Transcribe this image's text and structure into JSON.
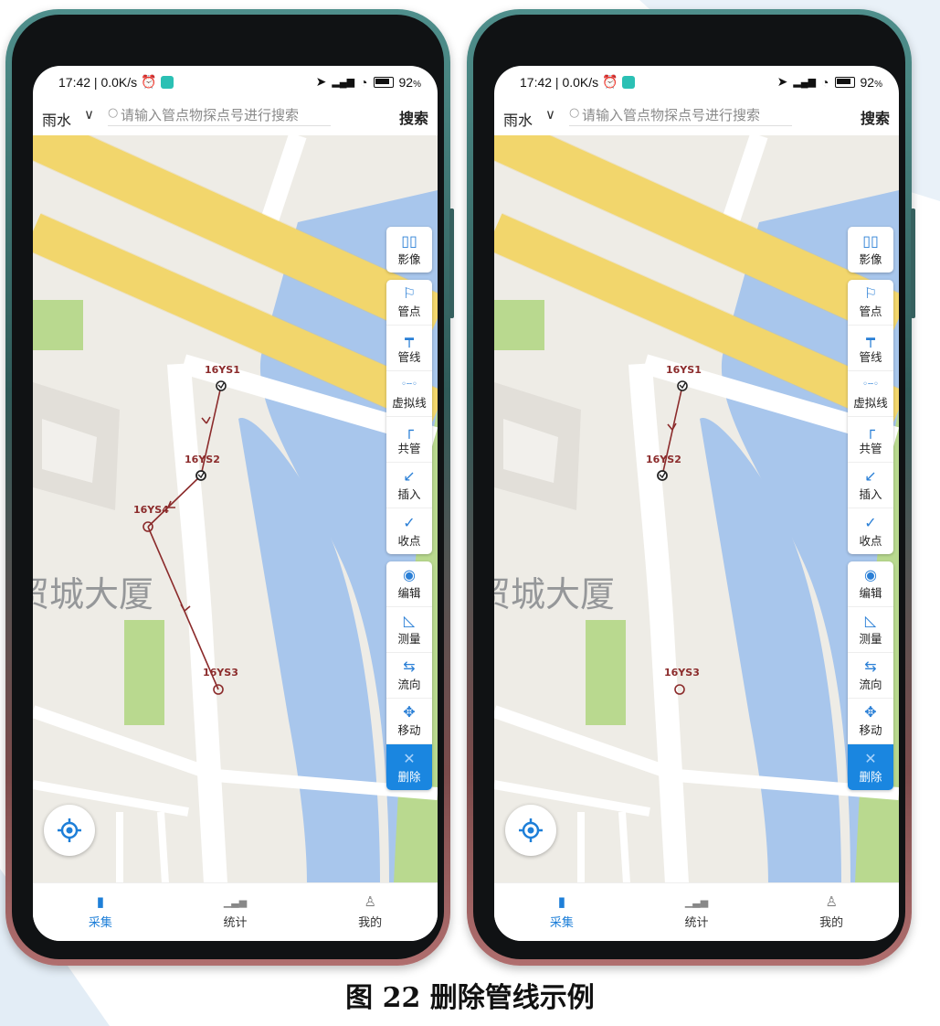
{
  "caption": "图 22 删除管线示例",
  "phones": [
    {
      "status": {
        "time": "17:42 | 0.0K/s",
        "battery": "92"
      },
      "search": {
        "category": "雨水",
        "placeholder": "请输入管点物探点号进行搜索",
        "button": "搜索"
      },
      "map_label": "贸城大厦",
      "points": [
        "16YS1",
        "16YS2",
        "16YS4",
        "16YS3"
      ],
      "toolbar": {
        "group1": [
          {
            "label": "影像",
            "icon": "map-icon"
          }
        ],
        "group2": [
          {
            "label": "管点",
            "icon": "flag-icon"
          },
          {
            "label": "管线",
            "icon": "pipe-line-icon"
          },
          {
            "label": "虚拟线",
            "icon": "dotted-line-icon"
          },
          {
            "label": "共管",
            "icon": "shared-pipe-icon"
          },
          {
            "label": "插入",
            "icon": "insert-icon"
          },
          {
            "label": "收点",
            "icon": "check-circle-icon"
          }
        ],
        "group3": [
          {
            "label": "编辑",
            "icon": "eye-icon"
          },
          {
            "label": "测量",
            "icon": "ruler-icon"
          },
          {
            "label": "流向",
            "icon": "flow-icon"
          },
          {
            "label": "移动",
            "icon": "move-icon"
          },
          {
            "label": "删除",
            "icon": "close-icon",
            "active": true
          }
        ]
      },
      "nav": [
        {
          "label": "采集",
          "icon": "map-icon",
          "active": true
        },
        {
          "label": "统计",
          "icon": "bar-chart-icon"
        },
        {
          "label": "我的",
          "icon": "user-icon"
        }
      ]
    },
    {
      "status": {
        "time": "17:42 | 0.0K/s",
        "battery": "92"
      },
      "search": {
        "category": "雨水",
        "placeholder": "请输入管点物探点号进行搜索",
        "button": "搜索"
      },
      "map_label": "贸城大厦",
      "points": [
        "16YS1",
        "16YS2",
        "16YS3"
      ],
      "toolbar": {
        "group1": [
          {
            "label": "影像",
            "icon": "map-icon"
          }
        ],
        "group2": [
          {
            "label": "管点",
            "icon": "flag-icon"
          },
          {
            "label": "管线",
            "icon": "pipe-line-icon"
          },
          {
            "label": "虚拟线",
            "icon": "dotted-line-icon"
          },
          {
            "label": "共管",
            "icon": "shared-pipe-icon"
          },
          {
            "label": "插入",
            "icon": "insert-icon"
          },
          {
            "label": "收点",
            "icon": "check-circle-icon"
          }
        ],
        "group3": [
          {
            "label": "编辑",
            "icon": "eye-icon"
          },
          {
            "label": "测量",
            "icon": "ruler-icon"
          },
          {
            "label": "流向",
            "icon": "flow-icon"
          },
          {
            "label": "移动",
            "icon": "move-icon"
          },
          {
            "label": "删除",
            "icon": "close-icon",
            "active": true
          }
        ]
      },
      "nav": [
        {
          "label": "采集",
          "icon": "map-icon",
          "active": true
        },
        {
          "label": "统计",
          "icon": "bar-chart-icon"
        },
        {
          "label": "我的",
          "icon": "user-icon"
        }
      ]
    }
  ]
}
